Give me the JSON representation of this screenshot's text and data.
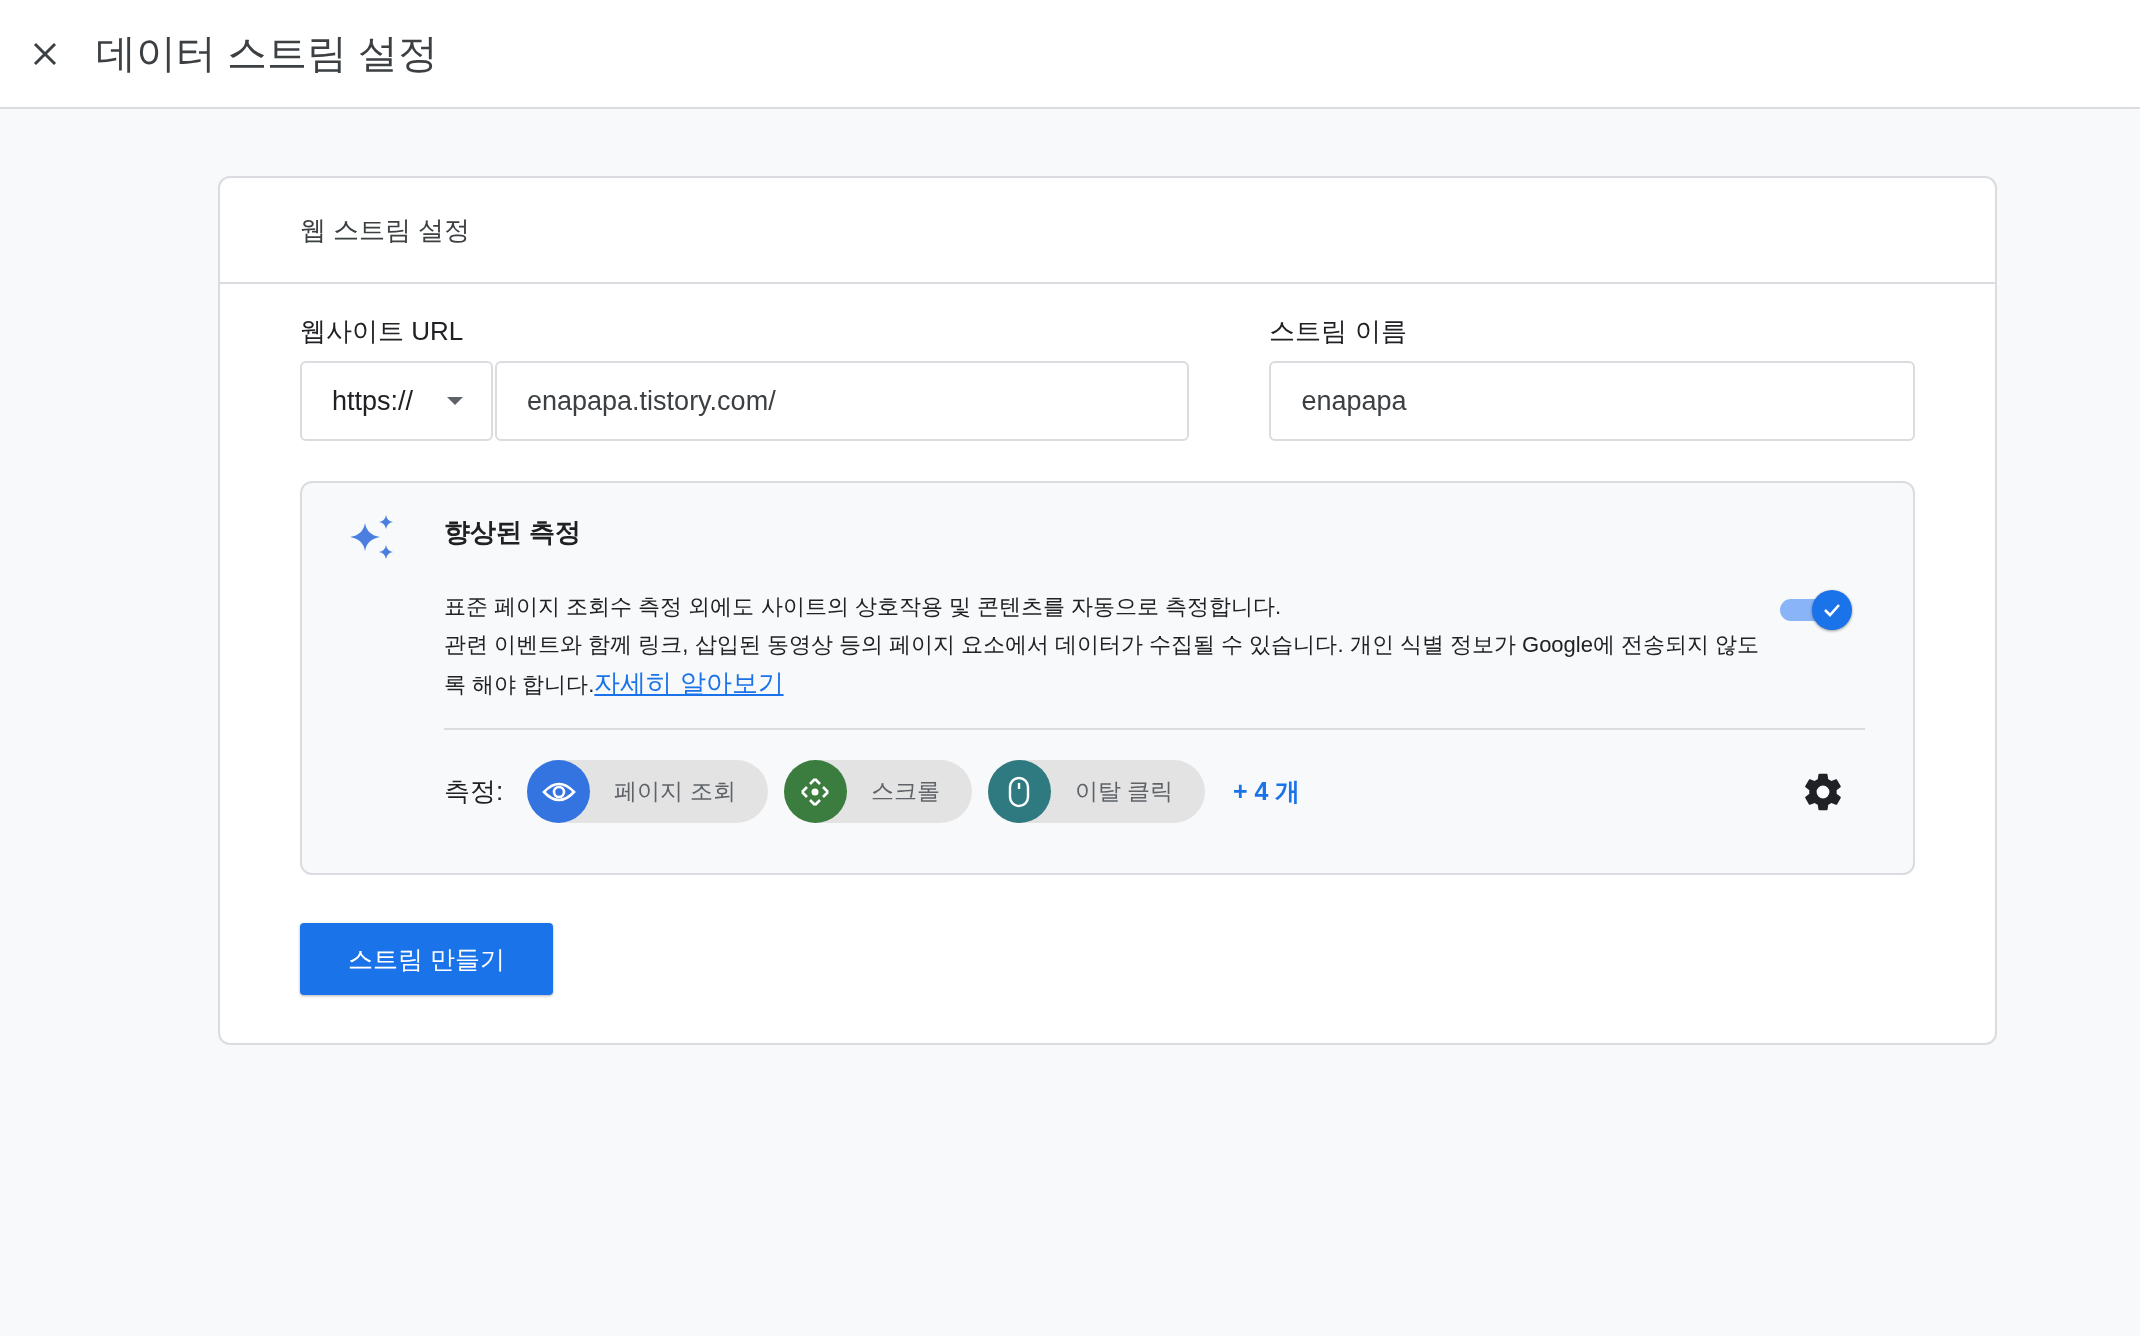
{
  "header": {
    "title": "데이터 스트림 설정"
  },
  "card": {
    "title": "웹 스트림 설정",
    "website_url": {
      "label": "웹사이트 URL",
      "protocol": "https://",
      "value": "enapapa.tistory.com/"
    },
    "stream_name": {
      "label": "스트림 이름",
      "value": "enapapa"
    },
    "enhanced_measurement": {
      "title": "향상된 측정",
      "on": true,
      "description": "표준 페이지 조회수 측정 외에도 사이트의 상호작용 및 콘텐츠를 자동으로 측정합니다.",
      "notice": "관련 이벤트와 함께 링크, 삽입된 동영상 등의 페이지 요소에서 데이터가 수집될 수 있습니다. 개인 식별 정보가 Google에 전송되지 않도록 해야 합니다.",
      "link": "자세히 알아보기",
      "measuring_label": "측정:",
      "chips": [
        {
          "kind": "eye",
          "label": "페이지 조회",
          "color": "#3474e0"
        },
        {
          "kind": "scroll",
          "label": "스크롤",
          "color": "#3a7d3e"
        },
        {
          "kind": "mouse",
          "label": "이탈 클릭",
          "color": "#2f7a80"
        }
      ],
      "more": "+ 4 개"
    },
    "create_button": "스트림 만들기"
  }
}
